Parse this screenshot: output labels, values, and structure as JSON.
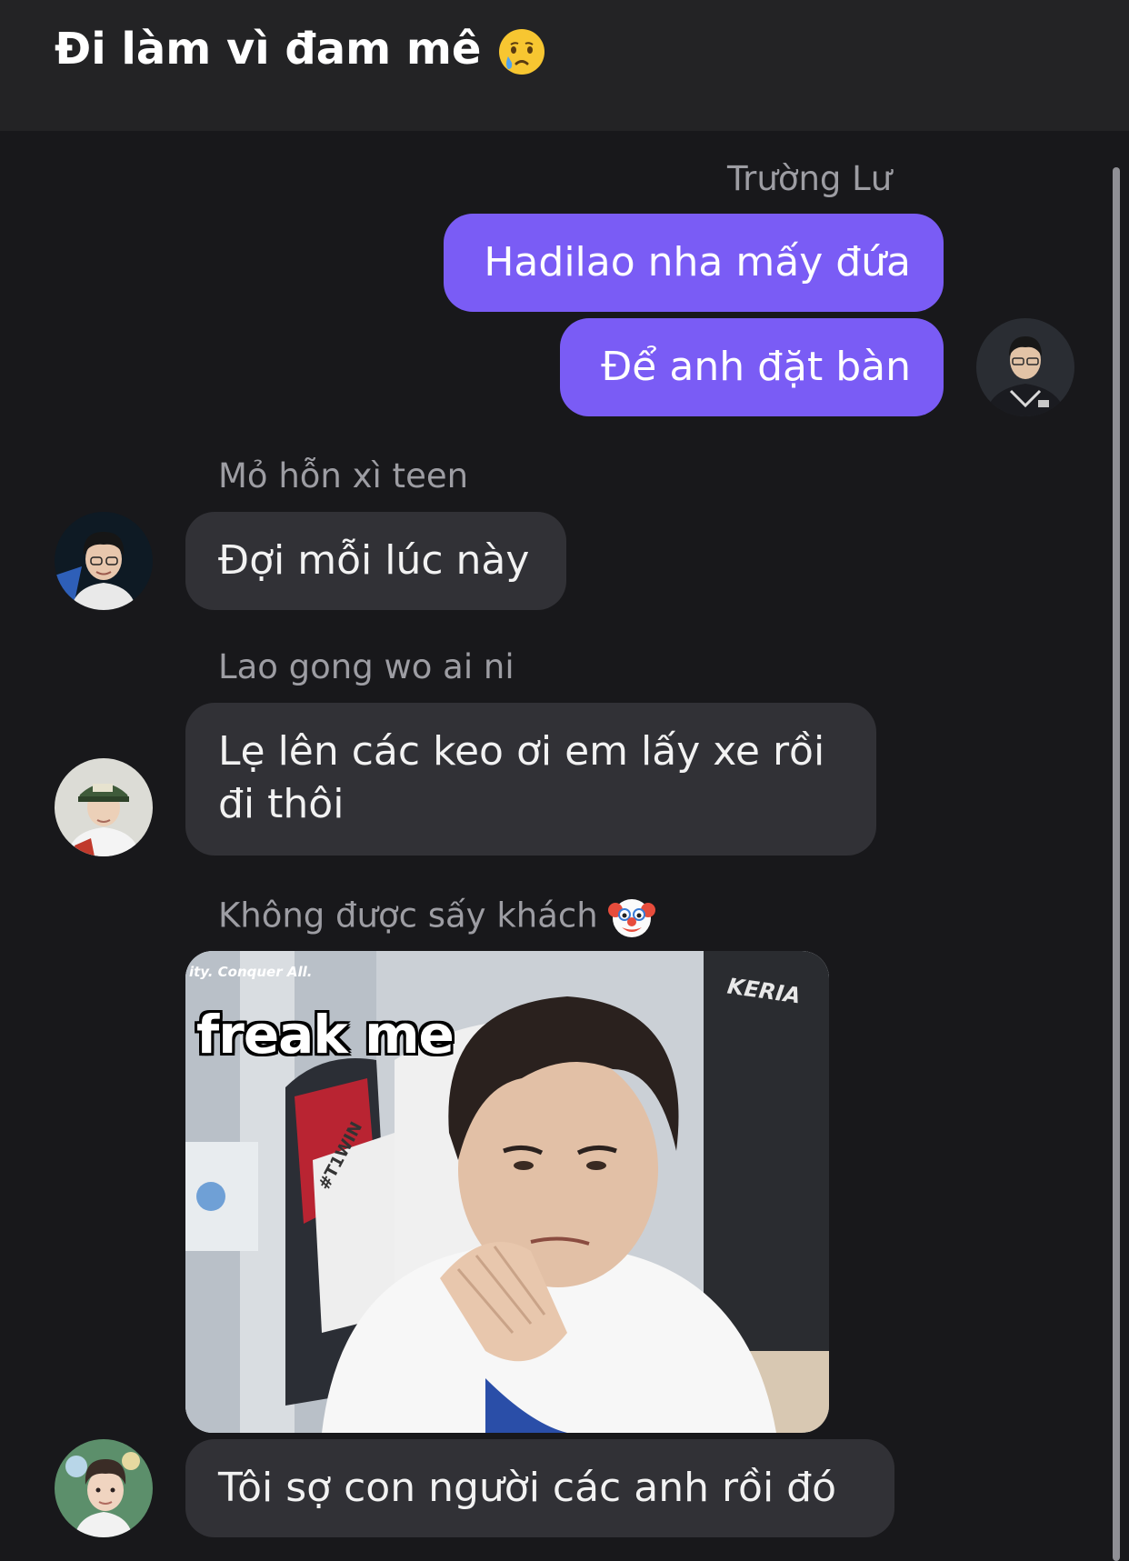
{
  "header": {
    "title": "Đi làm vì đam mê",
    "title_emoji": "crying-face-emoji"
  },
  "messages": [
    {
      "sender": "Trường Lư",
      "direction": "outgoing",
      "bubbles": [
        "Hadilao nha mấy đứa",
        "Để anh đặt bàn"
      ]
    },
    {
      "sender": "Mỏ hỗn xì teen",
      "direction": "incoming",
      "bubbles": [
        "Đợi mỗi lúc này"
      ]
    },
    {
      "sender": "Lao gong wo ai ni",
      "direction": "incoming",
      "bubbles": [
        "Lẹ lên các keo ơi em lấy xe rồi đi thôi"
      ]
    },
    {
      "sender": "Không được sấy khách",
      "sender_emoji": "clown-face-emoji",
      "direction": "incoming",
      "image": {
        "caption": "freak me",
        "corner_text": "ity. Conquer All.",
        "shirt_text": "#T1WIN",
        "banner_text": "KERIA"
      },
      "bubbles": [
        "Tôi sợ con người các anh rồi đó"
      ]
    }
  ],
  "colors": {
    "background": "#18181b",
    "header": "#232325",
    "outgoing_bubble": "#7a5cf5",
    "incoming_bubble": "#313136",
    "sender_name": "#9d9da3"
  }
}
